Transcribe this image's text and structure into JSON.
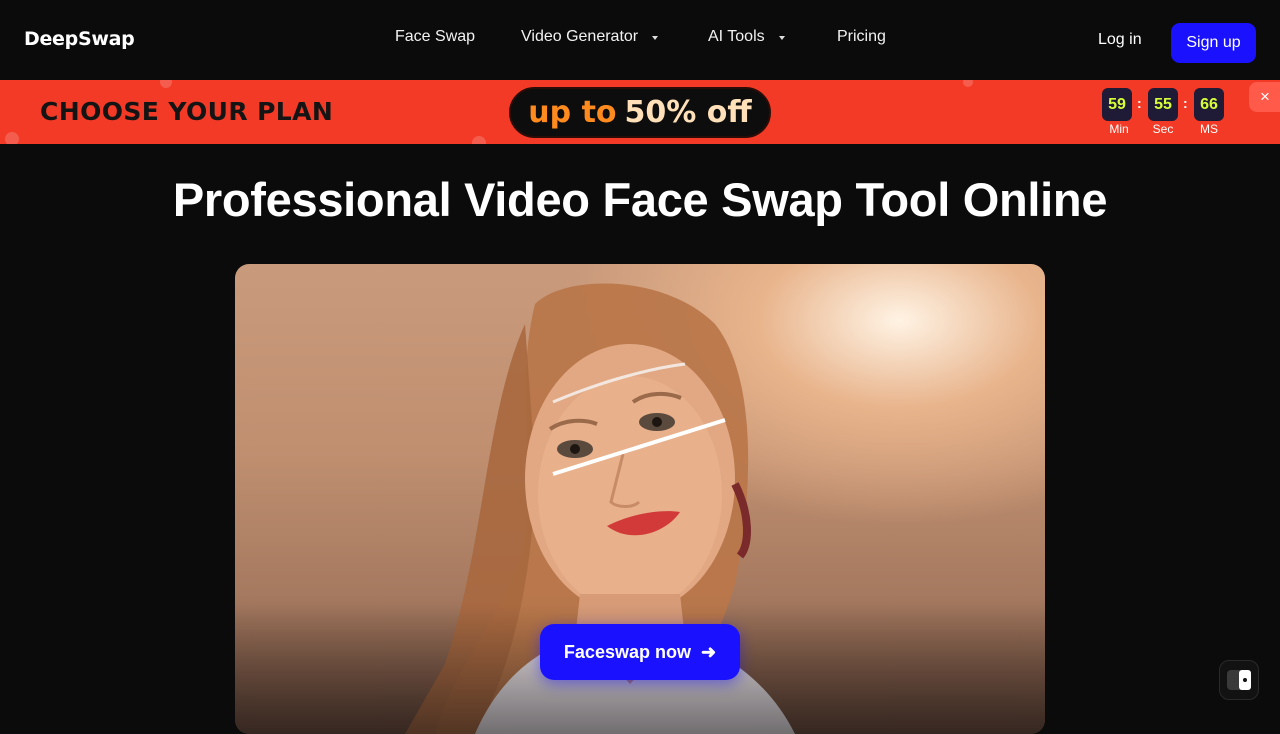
{
  "header": {
    "logo": "DeepSwap",
    "nav": [
      {
        "label": "Face Swap",
        "dropdown": false
      },
      {
        "label": "Video Generator",
        "dropdown": true
      },
      {
        "label": "AI Tools",
        "dropdown": true
      },
      {
        "label": "Pricing",
        "dropdown": false
      }
    ],
    "login_label": "Log in",
    "signup_label": "Sign up"
  },
  "promo": {
    "title": "CHOOSE YOUR PLAN",
    "offer_prefix": "up to",
    "offer_value": "50% off",
    "timer": {
      "minutes": "59",
      "seconds": "55",
      "ms": "66",
      "minutes_label": "Min",
      "seconds_label": "Sec",
      "ms_label": "MS",
      "separator": ":"
    },
    "close_icon": "×"
  },
  "hero": {
    "title": "Professional Video Face Swap Tool Online",
    "cta_label": "Faceswap now",
    "cta_arrow": "➜"
  },
  "colors": {
    "accent": "#1a12ff",
    "promo_bg": "#f23a26",
    "timer_digits": "#d6ff38",
    "offer_orange": "#ff8a1e"
  }
}
